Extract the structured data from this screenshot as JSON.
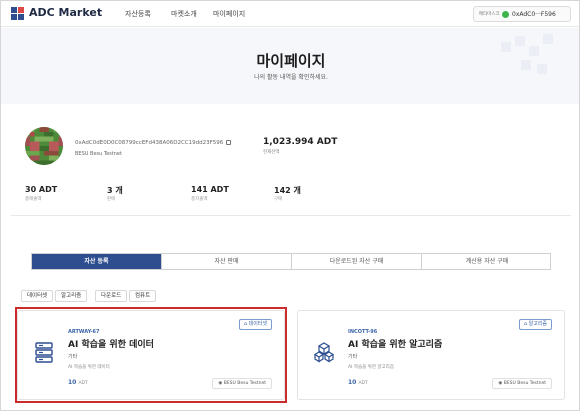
{
  "header": {
    "brand": "ADC Market",
    "nav": [
      "자산등록",
      "마켓소개",
      "마이페이지"
    ],
    "wallet_small": "메타마스크",
    "wallet_address": "0xAdC0···F596"
  },
  "hero": {
    "title": "마이페이지",
    "subtitle": "나의 활동 내역을 확인하세요."
  },
  "profile": {
    "address": "0xAdC0dE0D0C08799ccEFd438A06D2CC19dd23F596",
    "network": "BESU Besu Testnet",
    "balance": "1,023.994 ADT",
    "balance_label": "현재잔액"
  },
  "stats": [
    {
      "value": "30 ADT",
      "label": "총매출액"
    },
    {
      "value": "3 개",
      "label": "판매"
    },
    {
      "value": "141 ADT",
      "label": "총지출액"
    },
    {
      "value": "142 개",
      "label": "구매"
    }
  ],
  "tabs": [
    "자산 등록",
    "자산 판매",
    "다운로드된 자산 구매",
    "계산용 자산 구매"
  ],
  "filters": [
    "데이터셋",
    "알고리즘",
    "다운로드",
    "컴퓨트"
  ],
  "cards": [
    {
      "badge": "데이터셋",
      "code": "ARTWAY-67",
      "title": "AI 학습을 위한 데이터",
      "category": "기타",
      "description": "AI 학습을 위한 데이터",
      "price": "10",
      "unit": "ADT",
      "chain": "BESU Besu Testnet",
      "icon": "database-icon"
    },
    {
      "badge": "알고리즘",
      "code": "INCOTT-96",
      "title": "AI 학습을 위한 알고리즘",
      "category": "기타",
      "description": "AI 학습을 위한 알고리즘",
      "price": "10",
      "unit": "ADT",
      "chain": "BESU Besu Testnet",
      "icon": "cubes-icon"
    }
  ],
  "colors": {
    "accent": "#2e4e8f",
    "link": "#3b64a8",
    "highlight": "#cc2b2b"
  }
}
